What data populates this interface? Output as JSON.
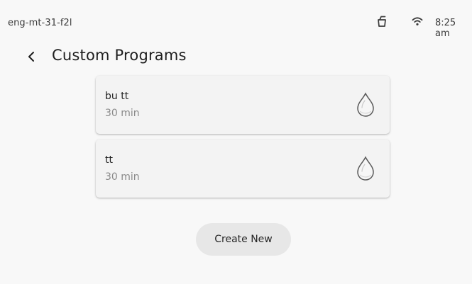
{
  "status_bar": {
    "device_name": "eng-mt-31-f2l",
    "icons": [
      "bucket-icon",
      "wifi-icon"
    ],
    "time": "8:25 am"
  },
  "header": {
    "back_icon": "chevron-left-icon",
    "title": "Custom Programs"
  },
  "programs": [
    {
      "name": "bu tt",
      "duration": "30 min",
      "icon": "water-drop-icon"
    },
    {
      "name": "tt",
      "duration": "30 min",
      "icon": "water-drop-icon"
    }
  ],
  "actions": {
    "create_label": "Create New"
  },
  "colors": {
    "background": "#f8f8f8",
    "card": "#f3f3f3",
    "button": "#e7e7e7",
    "secondary_text": "#8a8a8a"
  }
}
